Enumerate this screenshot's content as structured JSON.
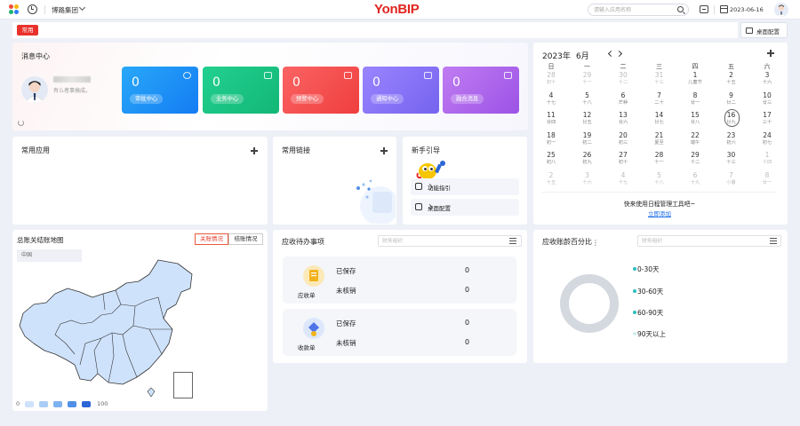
{
  "header": {
    "org_name": "博路集团",
    "logo": "YonBIP",
    "search_placeholder": "请输入应用名称",
    "date": "2023-06-16"
  },
  "tabs": {
    "common_label": "常用"
  },
  "desk_config_button": "桌面配置",
  "message_center": {
    "title": "消息中心",
    "no_info": "有么者事搞成。",
    "tiles": [
      {
        "count": "0",
        "label": "审批中心",
        "color": "#1f8ff5"
      },
      {
        "count": "0",
        "label": "业务中心",
        "color": "#1cc583"
      },
      {
        "count": "0",
        "label": "预警中心",
        "color": "#f44d4d"
      },
      {
        "count": "0",
        "label": "通知中心",
        "color": "#8873f7"
      },
      {
        "count": "0",
        "label": "融合消息",
        "color": "#ad66ec"
      }
    ]
  },
  "calendar": {
    "year": "2023年",
    "month": "6月",
    "weekdays": [
      "日",
      "一",
      "二",
      "三",
      "四",
      "五",
      "六"
    ],
    "weeks": [
      [
        {
          "d": "28",
          "l": "初十",
          "o": true
        },
        {
          "d": "29",
          "l": "十一",
          "o": true
        },
        {
          "d": "30",
          "l": "十二",
          "o": true
        },
        {
          "d": "31",
          "l": "十三",
          "o": true
        },
        {
          "d": "1",
          "l": "儿童节"
        },
        {
          "d": "2",
          "l": "十五"
        },
        {
          "d": "3",
          "l": "十六"
        }
      ],
      [
        {
          "d": "4",
          "l": "十七"
        },
        {
          "d": "5",
          "l": "十八"
        },
        {
          "d": "6",
          "l": "芒种"
        },
        {
          "d": "7",
          "l": "二十"
        },
        {
          "d": "8",
          "l": "廿一"
        },
        {
          "d": "9",
          "l": "廿二"
        },
        {
          "d": "10",
          "l": "廿三"
        }
      ],
      [
        {
          "d": "11",
          "l": "廿四"
        },
        {
          "d": "12",
          "l": "廿五"
        },
        {
          "d": "13",
          "l": "廿六"
        },
        {
          "d": "14",
          "l": "廿七"
        },
        {
          "d": "15",
          "l": "廿八"
        },
        {
          "d": "16",
          "l": "廿九",
          "t": true
        },
        {
          "d": "17",
          "l": "三十"
        }
      ],
      [
        {
          "d": "18",
          "l": "初一"
        },
        {
          "d": "19",
          "l": "初二"
        },
        {
          "d": "20",
          "l": "初三"
        },
        {
          "d": "21",
          "l": "夏至"
        },
        {
          "d": "22",
          "l": "端午"
        },
        {
          "d": "23",
          "l": "初六"
        },
        {
          "d": "24",
          "l": "初七"
        }
      ],
      [
        {
          "d": "25",
          "l": "初八"
        },
        {
          "d": "26",
          "l": "初九"
        },
        {
          "d": "27",
          "l": "初十"
        },
        {
          "d": "28",
          "l": "十一"
        },
        {
          "d": "29",
          "l": "十二"
        },
        {
          "d": "30",
          "l": "十三"
        },
        {
          "d": "1",
          "l": "十四",
          "o": true
        }
      ],
      [
        {
          "d": "2",
          "l": "十五",
          "o": true
        },
        {
          "d": "3",
          "l": "十六",
          "o": true
        },
        {
          "d": "4",
          "l": "十七",
          "o": true
        },
        {
          "d": "5",
          "l": "十八",
          "o": true
        },
        {
          "d": "6",
          "l": "十九",
          "o": true
        },
        {
          "d": "7",
          "l": "小暑",
          "o": true
        },
        {
          "d": "8",
          "l": "廿一",
          "o": true
        }
      ]
    ],
    "tip": "快来使用日程管理工具吧~",
    "link": "立即添加"
  },
  "common_apps": {
    "title": "常用应用"
  },
  "common_links": {
    "title": "常用链接"
  },
  "guide": {
    "title": "新手引导",
    "items": [
      {
        "label": "功能指引"
      },
      {
        "label": "桌面配置"
      }
    ]
  },
  "map": {
    "title": "总账关结账地图",
    "tab_active": "关账情况",
    "tab_other": "结账情况",
    "region_label": "中国",
    "legend_min": "0",
    "legend_max": "100",
    "legend_colors": [
      "#cfe2fb",
      "#a9cdf6",
      "#7fb2f0",
      "#4f8fe6",
      "#2c66d6"
    ]
  },
  "todo": {
    "title": "应收待办事项",
    "search_placeholder": "财务组织",
    "items": [
      {
        "name": "应收单",
        "row1_label": "已保存",
        "row1_value": "0",
        "row2_label": "未核销",
        "row2_value": "0"
      },
      {
        "name": "收款单",
        "row1_label": "已保存",
        "row1_value": "0",
        "row2_label": "未核销",
        "row2_value": "0"
      }
    ]
  },
  "aging": {
    "title": "应收账龄百分比",
    "search_placeholder": "财务组织",
    "legend": [
      {
        "label": "0-30天",
        "color": "#2bbfbf"
      },
      {
        "label": "30-60天",
        "color": "#2bbfbf"
      },
      {
        "label": "60-90天",
        "color": "#2bbfbf"
      },
      {
        "label": "90天以上",
        "color": "#cfeeee"
      }
    ]
  }
}
